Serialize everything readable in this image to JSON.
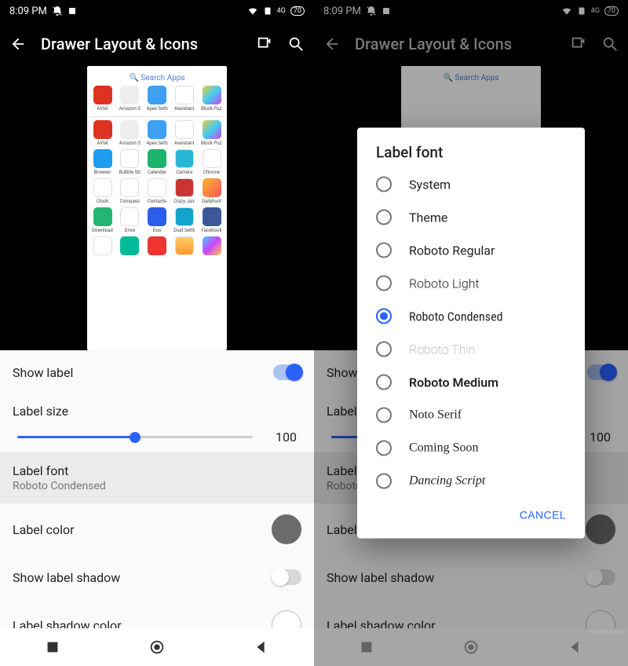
{
  "statusbar": {
    "time": "8:09 PM",
    "battery": "70"
  },
  "appbar": {
    "title": "Drawer Layout & Icons"
  },
  "preview": {
    "search_label": "Search Apps",
    "apps_r1": [
      "Airtel",
      "Amazon Sh..",
      "Apex Settin..",
      "Assistant",
      "Block Puzz.."
    ],
    "apps_r2": [
      "Airtel",
      "Amazon Sh..",
      "Apex Settin..",
      "Assistant",
      "Block Puzz.."
    ],
    "apps_r3": [
      "Browser",
      "Bubble Story",
      "Calendar",
      "Camera",
      "Chrome"
    ],
    "apps_r4": [
      "Clock",
      "Compass",
      "Contacts",
      "Crazy Juicer",
      "Dailyhunt"
    ],
    "apps_r5": [
      "Downloads",
      "Drive",
      "Duo",
      "Dust Settle",
      "Facebook"
    ],
    "apps_r6": [
      "",
      "",
      "",
      "",
      ""
    ]
  },
  "settings": {
    "show_label": "Show label",
    "label_size": "Label size",
    "label_size_value": "100",
    "label_font": "Label font",
    "label_font_value": "Roboto Condensed",
    "label_color": "Label color",
    "show_label_shadow": "Show label shadow",
    "label_shadow_color": "Label shadow color"
  },
  "dialog": {
    "title": "Label font",
    "options": [
      "System",
      "Theme",
      "Roboto Regular",
      "Roboto Light",
      "Roboto Condensed",
      "Roboto Thin",
      "Roboto Medium",
      "Noto Serif",
      "Coming Soon",
      "Dancing Script"
    ],
    "selected_index": 4,
    "cancel": "CANCEL"
  },
  "watermark": "wcaln.com"
}
